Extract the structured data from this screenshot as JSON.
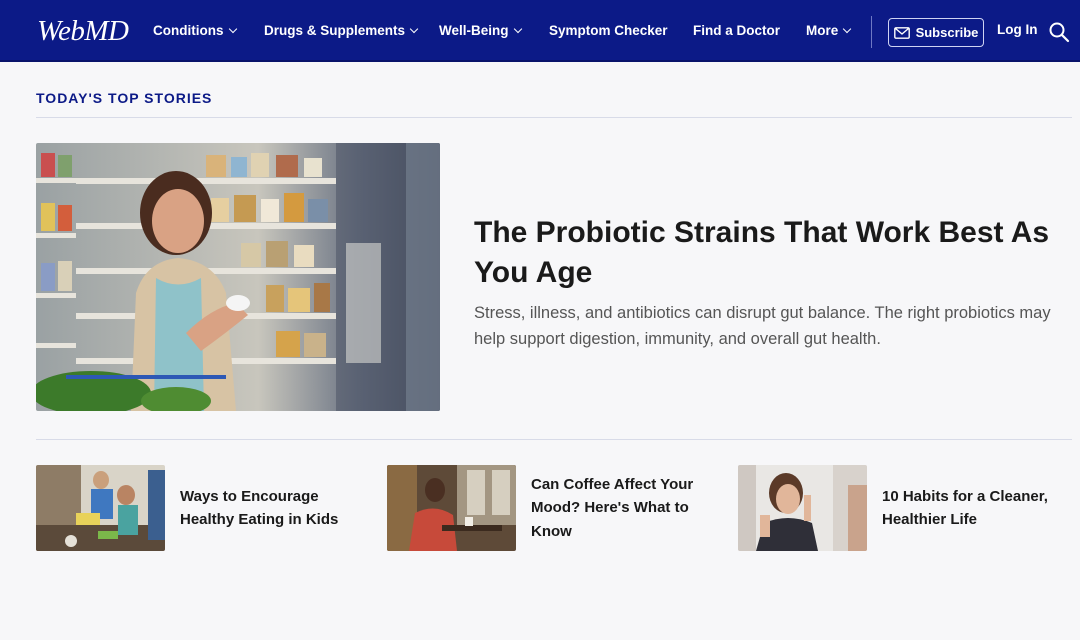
{
  "header": {
    "logo": "WebMD",
    "nav": [
      {
        "label": "Conditions",
        "dropdown": true
      },
      {
        "label": "Drugs & Supplements",
        "dropdown": true
      },
      {
        "label": "Well-Being",
        "dropdown": true
      },
      {
        "label": "Symptom Checker",
        "dropdown": false
      },
      {
        "label": "Find a Doctor",
        "dropdown": false
      },
      {
        "label": "More",
        "dropdown": true
      }
    ],
    "subscribe_label": "Subscribe",
    "login_label": "Log In",
    "bg_color": "#0c1a87"
  },
  "section": {
    "title": "TODAY'S TOP STORIES"
  },
  "hero": {
    "title": "The Probiotic Strains That Work Best As You Age",
    "description": "Stress, illness, and antibiotics can disrupt gut balance. The right probiotics may help support digestion, immunity, and overall gut health."
  },
  "stories": [
    {
      "title": "Ways to Encourage Healthy Eating in Kids"
    },
    {
      "title": "Can Coffee Affect Your Mood? Here's What to Know"
    },
    {
      "title": "10 Habits for a Cleaner, Healthier Life"
    }
  ]
}
